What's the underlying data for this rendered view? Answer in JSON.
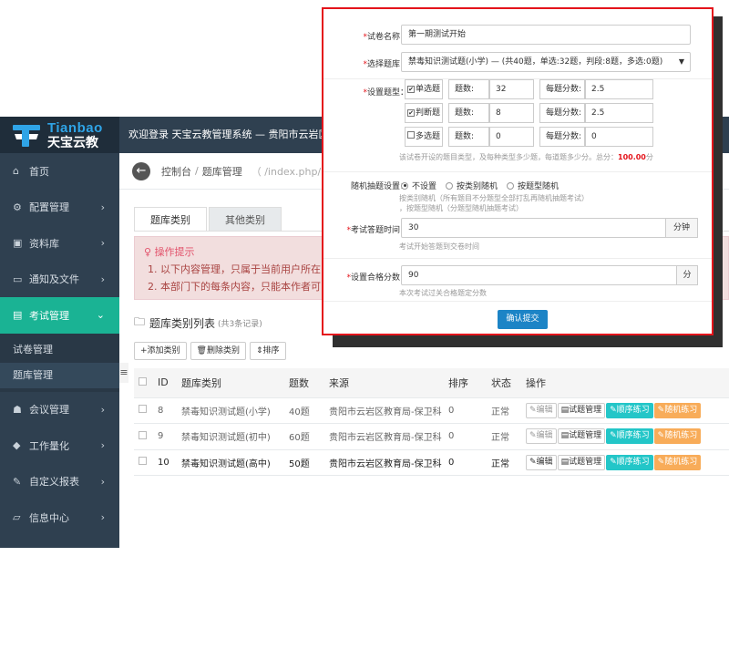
{
  "brand": {
    "name_en": "Tianbao",
    "name_cn": "天宝云教"
  },
  "topbar": {
    "welcome": "欢迎登录 天宝云教管理系统 — 贵阳市云岩区教育"
  },
  "sidebar": {
    "items": [
      {
        "icon": "home-icon",
        "glyph": "⌂",
        "label": "首页"
      },
      {
        "icon": "gear-icon",
        "glyph": "⚙",
        "label": "配置管理"
      },
      {
        "icon": "file-icon",
        "glyph": "▣",
        "label": "资料库"
      },
      {
        "icon": "folder-icon",
        "glyph": "▭",
        "label": "通知及文件"
      },
      {
        "icon": "book-icon",
        "glyph": "▤",
        "label": "考试管理"
      }
    ],
    "sub_items": [
      {
        "label": "试卷管理"
      },
      {
        "label": "题库管理"
      }
    ],
    "items_after": [
      {
        "icon": "users-icon",
        "glyph": "☗",
        "label": "会议管理"
      },
      {
        "icon": "cube-icon",
        "glyph": "◆",
        "label": "工作量化"
      },
      {
        "icon": "edit-icon",
        "glyph": "✎",
        "label": "自定义报表"
      },
      {
        "icon": "folder-open-icon",
        "glyph": "▱",
        "label": "信息中心"
      }
    ]
  },
  "breadcrumb": {
    "home": "控制台",
    "sep": "/",
    "current": "题库管理",
    "path": "（ /index.php/in"
  },
  "tabs": [
    {
      "label": "题库类别"
    },
    {
      "label": "其他类别"
    }
  ],
  "alert": {
    "title": "操作提示",
    "lines": [
      "以下内容管理，只属于当前用户所在",
      "本部门下的每条内容，只能本作者可"
    ]
  },
  "list": {
    "title": "题库类别列表",
    "count": "(共3条记录)"
  },
  "toolbar": {
    "add": "+添加类别",
    "delete": "删除类别",
    "sort": "排序"
  },
  "table": {
    "headers": [
      "ID",
      "题库类别",
      "题数",
      "来源",
      "排序",
      "状态",
      "操作"
    ],
    "rows": [
      {
        "id": "8",
        "name": "禁毒知识测试题(小学)",
        "count": "40题",
        "source": "贵阳市云岩区教育局-保卫科",
        "sort": "0",
        "status": "正常"
      },
      {
        "id": "9",
        "name": "禁毒知识测试题(初中)",
        "count": "60题",
        "source": "贵阳市云岩区教育局-保卫科",
        "sort": "0",
        "status": "正常"
      },
      {
        "id": "10",
        "name": "禁毒知识测试题(高中)",
        "count": "50题",
        "source": "贵阳市云岩区教育局-保卫科",
        "sort": "0",
        "status": "正常"
      }
    ],
    "actions": {
      "edit": "编辑",
      "manage": "试题管理",
      "sequential": "顺序练习",
      "random": "随机练习"
    }
  },
  "modal": {
    "req_mark": "*",
    "paper_name": {
      "label": "试卷名称：",
      "value": "第一期测试开始"
    },
    "bank": {
      "label": "选择题库：",
      "value": "禁毒知识测试题(小学) — (共40题，单选:32题，判段:8题，多选:0题)"
    },
    "types": {
      "label": "设置题型：",
      "count_label": "题数:",
      "score_label": "每题分数:",
      "rows": [
        {
          "name": "单选题",
          "checked": "✔",
          "count": "32",
          "score": "2.5"
        },
        {
          "name": "判断题",
          "checked": "✔",
          "count": "8",
          "score": "2.5"
        },
        {
          "name": "多选题",
          "checked": "",
          "count": "0",
          "score": "0"
        }
      ],
      "help": "该试卷开设的题目类型，及每种类型多少题，每道题多少分。总分：",
      "total": "100.00",
      "total_unit": "分"
    },
    "random": {
      "label": "随机抽题设置：",
      "options": [
        "不设置",
        "按类别随机",
        "按题型随机"
      ],
      "help1": "按类别随机（所有题目不分题型全部打乱再随机抽题考试）",
      "help2": "，按题型随机（分题型随机抽题考试）"
    },
    "time": {
      "label": "考试答题时间：",
      "value": "30",
      "unit": "分钟",
      "help": "考试开始答题到交卷时间"
    },
    "pass": {
      "label": "设置合格分数：",
      "value": "90",
      "unit": "分",
      "help": "本次考试过关合格题定分数"
    },
    "submit": "确认提交"
  },
  "colors": {
    "sidebar_bg": "#2f4050",
    "active_green": "#1ab394",
    "modal_border": "#e4141b",
    "primary_blue": "#1c84c6",
    "seq_cyan": "#23c6c8",
    "rnd_orange": "#f8ac59"
  }
}
